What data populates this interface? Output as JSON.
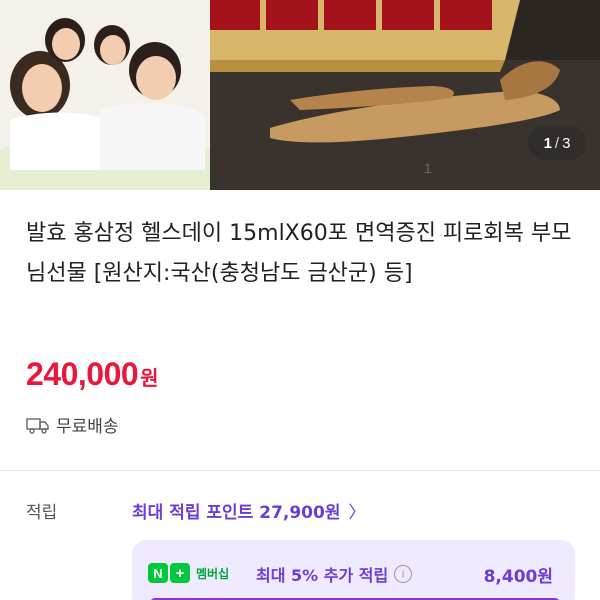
{
  "gallery": {
    "current": "1",
    "separator": "/",
    "total": "3",
    "watermark": "1"
  },
  "product": {
    "title": "발효 홍삼정 헬스데이 15mlX60포 면역증진 피로회복 부모님선물 [원산지:국산(충청남도 금산군) 등]",
    "price": "240,000",
    "price_unit": "원",
    "shipping": "무료배송"
  },
  "points": {
    "label": "적립",
    "max_points_link": "최대 적립 포인트 27,900원",
    "chevron": "〉"
  },
  "membership": {
    "badge_n": "N",
    "badge_plus": "+",
    "badge_text": "멤버십",
    "label": "최대 5% 추가 적립",
    "info": "i",
    "value": "8,400원"
  },
  "colors": {
    "price": "#e8173c",
    "accent_purple": "#6b3dd6",
    "membership_bg": "#efeaff",
    "naver_green": "#00c73c"
  },
  "icons": {
    "shipping": "truck-icon",
    "info": "info-icon",
    "chevron": "chevron-right-icon"
  }
}
